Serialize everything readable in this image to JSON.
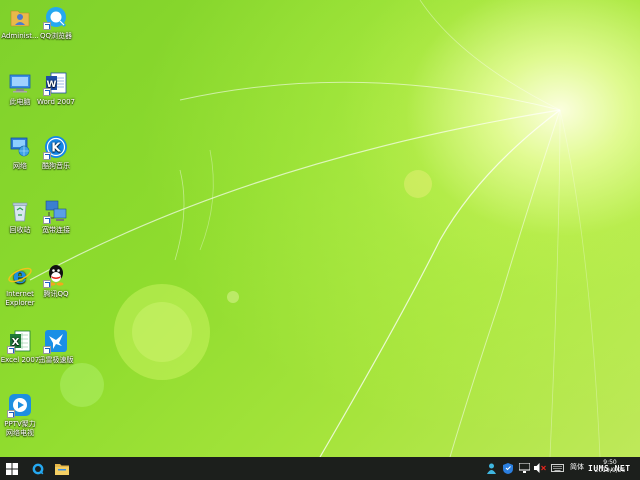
{
  "desktop": {
    "icons": [
      {
        "label": "Administ...",
        "icon": "user-folder-icon"
      },
      {
        "label": "QQ浏览器",
        "icon": "qq-browser-icon"
      },
      {
        "label": "此电脑",
        "icon": "computer-icon"
      },
      {
        "label": "Word 2007",
        "icon": "word-icon"
      },
      {
        "label": "网络",
        "icon": "network-icon"
      },
      {
        "label": "酷狗音乐",
        "icon": "kugou-icon"
      },
      {
        "label": "回收站",
        "icon": "recycle-bin-icon"
      },
      {
        "label": "宽带连接",
        "icon": "broadband-icon"
      },
      {
        "label": "Internet Explorer",
        "icon": "ie-icon"
      },
      {
        "label": "腾讯QQ",
        "icon": "qq-icon"
      },
      {
        "label": "Excel 2007",
        "icon": "excel-icon"
      },
      {
        "label": "迅雷极速版",
        "icon": "thunder-icon"
      },
      {
        "label": "PPTV聚力 网络电视",
        "icon": "pptv-icon"
      }
    ]
  },
  "taskbar": {
    "start_icon": "windows-logo-icon",
    "pinned": [
      "qq-browser-icon",
      "file-explorer-icon"
    ],
    "tray": {
      "ime_label": "简体",
      "clock_time": "9:50",
      "clock_date": "2019/9/26"
    }
  },
  "watermark": "IUMS.NET",
  "colors": {
    "wallpaper_base": "#8fdc2e",
    "taskbar": "#1c1f1c"
  }
}
